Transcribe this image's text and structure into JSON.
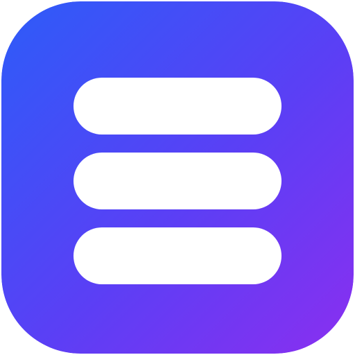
{
  "icon": {
    "name": "menu-icon",
    "bar_count": 3,
    "colors": {
      "gradient_start": "#2d5cf9",
      "gradient_mid": "#5b3ff5",
      "gradient_end": "#8a2ff0",
      "bars": "#ffffff",
      "page_background": "#ffffff"
    }
  }
}
